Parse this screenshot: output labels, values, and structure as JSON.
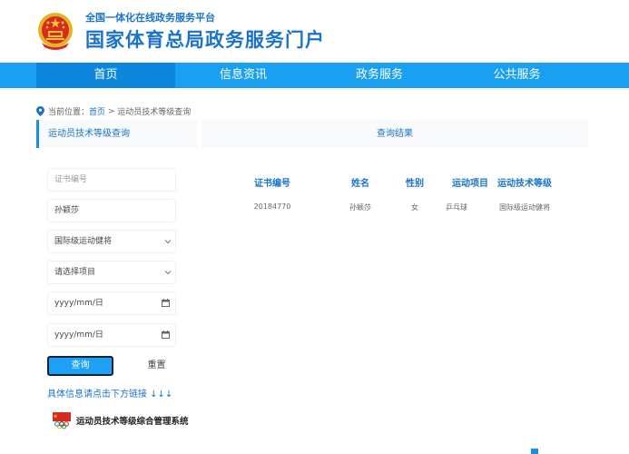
{
  "header": {
    "subtitle": "全国一体化在线政务服务平台",
    "title": "国家体育总局政务服务门户"
  },
  "nav": {
    "items": [
      {
        "label": "首页",
        "active": true
      },
      {
        "label": "信息资讯",
        "active": false
      },
      {
        "label": "政务服务",
        "active": false
      },
      {
        "label": "公共服务",
        "active": false
      }
    ]
  },
  "breadcrumb": {
    "prefix": "当前位置：",
    "home": "首页",
    "separator": " > ",
    "current": "运动员技术等级查询"
  },
  "left_panel": {
    "title": "运动员技术等级查询"
  },
  "right_panel": {
    "title": "查询结果"
  },
  "form": {
    "certificate_placeholder": "证书编号",
    "name_value": "孙颖莎",
    "level_value": "国际级运动健将",
    "sport_placeholder": "请选择项目",
    "date_start_placeholder": "yyyy/mm/日",
    "date_end_placeholder": "yyyy/mm/日",
    "query_label": "查询",
    "reset_label": "重置"
  },
  "hint": {
    "text": "具体信息请点击下方链接 ↓↓↓"
  },
  "system": {
    "name": "运动员技术等级综合管理系统"
  },
  "results": {
    "columns": [
      "证书编号",
      "姓名",
      "性别",
      "运动项目",
      "运动技术等级"
    ],
    "rows": [
      [
        "20184770",
        "孙颖莎",
        "女",
        "乒乓球",
        "国际级运动健将"
      ]
    ]
  },
  "colors": {
    "brand_blue": "#1a73c9",
    "nav_bg": "#1aa0f0",
    "nav_active": "#0d87dc",
    "button_bg": "#1ea0f5"
  }
}
